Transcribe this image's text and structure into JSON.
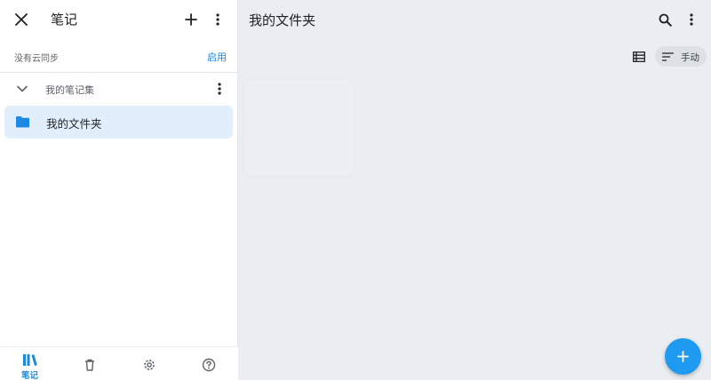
{
  "colors": {
    "accent": "#1a8ad8",
    "folder_icon": "#1e88e5",
    "selected_bg": "#e0effb",
    "fab": "#1e9bf0"
  },
  "sidebar": {
    "title": "笔记",
    "close_icon": "close-icon",
    "add_icon": "plus-icon",
    "more_icon": "more-vert-icon",
    "sync_status": "没有云同步",
    "sync_action": "启用",
    "collection": {
      "label": "我的笔记集",
      "expand_icon": "chevron-down-icon",
      "more_icon": "more-vert-icon"
    },
    "folders": [
      {
        "label": "我的文件夹",
        "icon": "folder-icon",
        "selected": true
      }
    ]
  },
  "bottom_nav": [
    {
      "label": "笔记",
      "icon": "books-icon",
      "active": true
    },
    {
      "label": "",
      "icon": "trash-icon",
      "active": false
    },
    {
      "label": "",
      "icon": "gear-icon",
      "active": false
    },
    {
      "label": "",
      "icon": "help-icon",
      "active": false
    }
  ],
  "main": {
    "title": "我的文件夹",
    "search_icon": "search-icon",
    "more_icon": "more-vert-icon",
    "view_icon": "list-view-icon",
    "sort": {
      "label": "手动",
      "icon": "sort-icon"
    },
    "fab_icon": "plus-icon"
  }
}
